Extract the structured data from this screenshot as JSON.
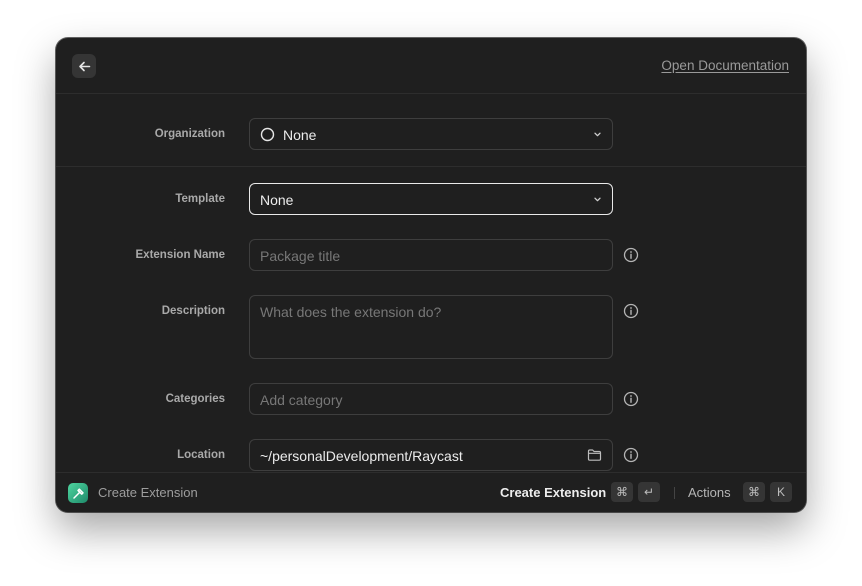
{
  "header": {
    "back_icon": "arrow-left-icon",
    "doc_link": "Open Documentation"
  },
  "form": {
    "organization": {
      "label": "Organization",
      "value": "None",
      "icon": "circle-icon"
    },
    "template": {
      "label": "Template",
      "value": "None"
    },
    "extension_name": {
      "label": "Extension Name",
      "placeholder": "Package title"
    },
    "description": {
      "label": "Description",
      "placeholder": "What does the extension do?"
    },
    "categories": {
      "label": "Categories",
      "placeholder": "Add category"
    },
    "location": {
      "label": "Location",
      "value": "~/personalDevelopment/Raycast",
      "icon": "folder-icon"
    }
  },
  "footer": {
    "title": "Create Extension",
    "primary_action": "Create Extension",
    "primary_shortcut": [
      "⌘",
      "↵"
    ],
    "actions_label": "Actions",
    "actions_shortcut": [
      "⌘",
      "K"
    ]
  },
  "colors": {
    "window_bg": "#1f1f1f",
    "border": "#3e3e3e",
    "focus_border": "#e9e9e9",
    "accent_logo": "#3fbf8f"
  }
}
